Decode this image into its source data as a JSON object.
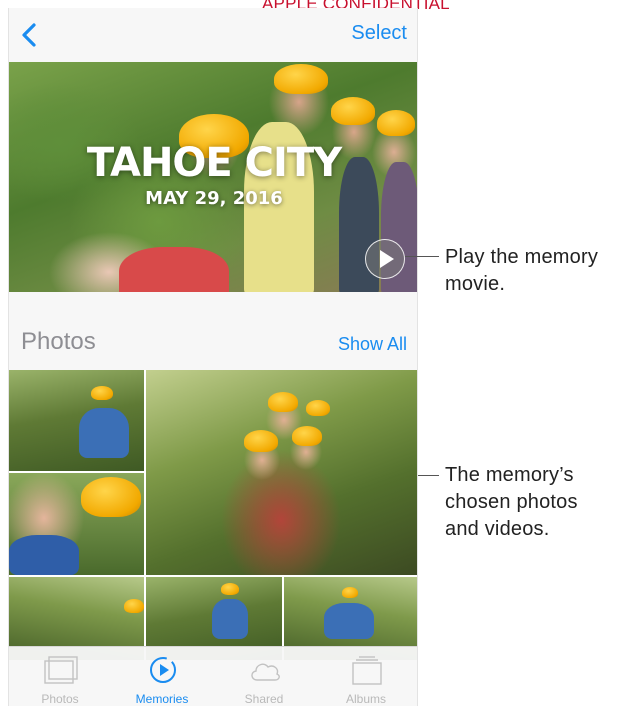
{
  "watermark": "APPLE CONFIDENTIAL",
  "navbar": {
    "back_icon": "chevron-left-icon",
    "select_label": "Select"
  },
  "hero": {
    "title": "TAHOE CITY",
    "date": "MAY 29, 2016",
    "play_icon": "play-icon"
  },
  "photos_section": {
    "title": "Photos",
    "show_all_label": "Show All"
  },
  "photo_tiles": [
    {
      "desc": "girl-on-bridge"
    },
    {
      "desc": "big-group-zipline"
    },
    {
      "desc": "two-girls-helmets"
    },
    {
      "desc": "forest-1"
    },
    {
      "desc": "forest-2"
    },
    {
      "desc": "forest-3"
    }
  ],
  "tabbar": {
    "tabs": [
      {
        "label": "Photos",
        "icon": "photos-icon",
        "active": false
      },
      {
        "label": "Memories",
        "icon": "memories-icon",
        "active": true
      },
      {
        "label": "Shared",
        "icon": "cloud-icon",
        "active": false
      },
      {
        "label": "Albums",
        "icon": "albums-icon",
        "active": false
      }
    ]
  },
  "callouts": {
    "play": [
      "Play the memory",
      "movie."
    ],
    "photos": [
      "The memory’s",
      "chosen photos",
      "and videos."
    ]
  },
  "colors": {
    "accent": "#1a8cf0",
    "watermark": "#c8102e",
    "tab_inactive": "#b9b9b9"
  }
}
